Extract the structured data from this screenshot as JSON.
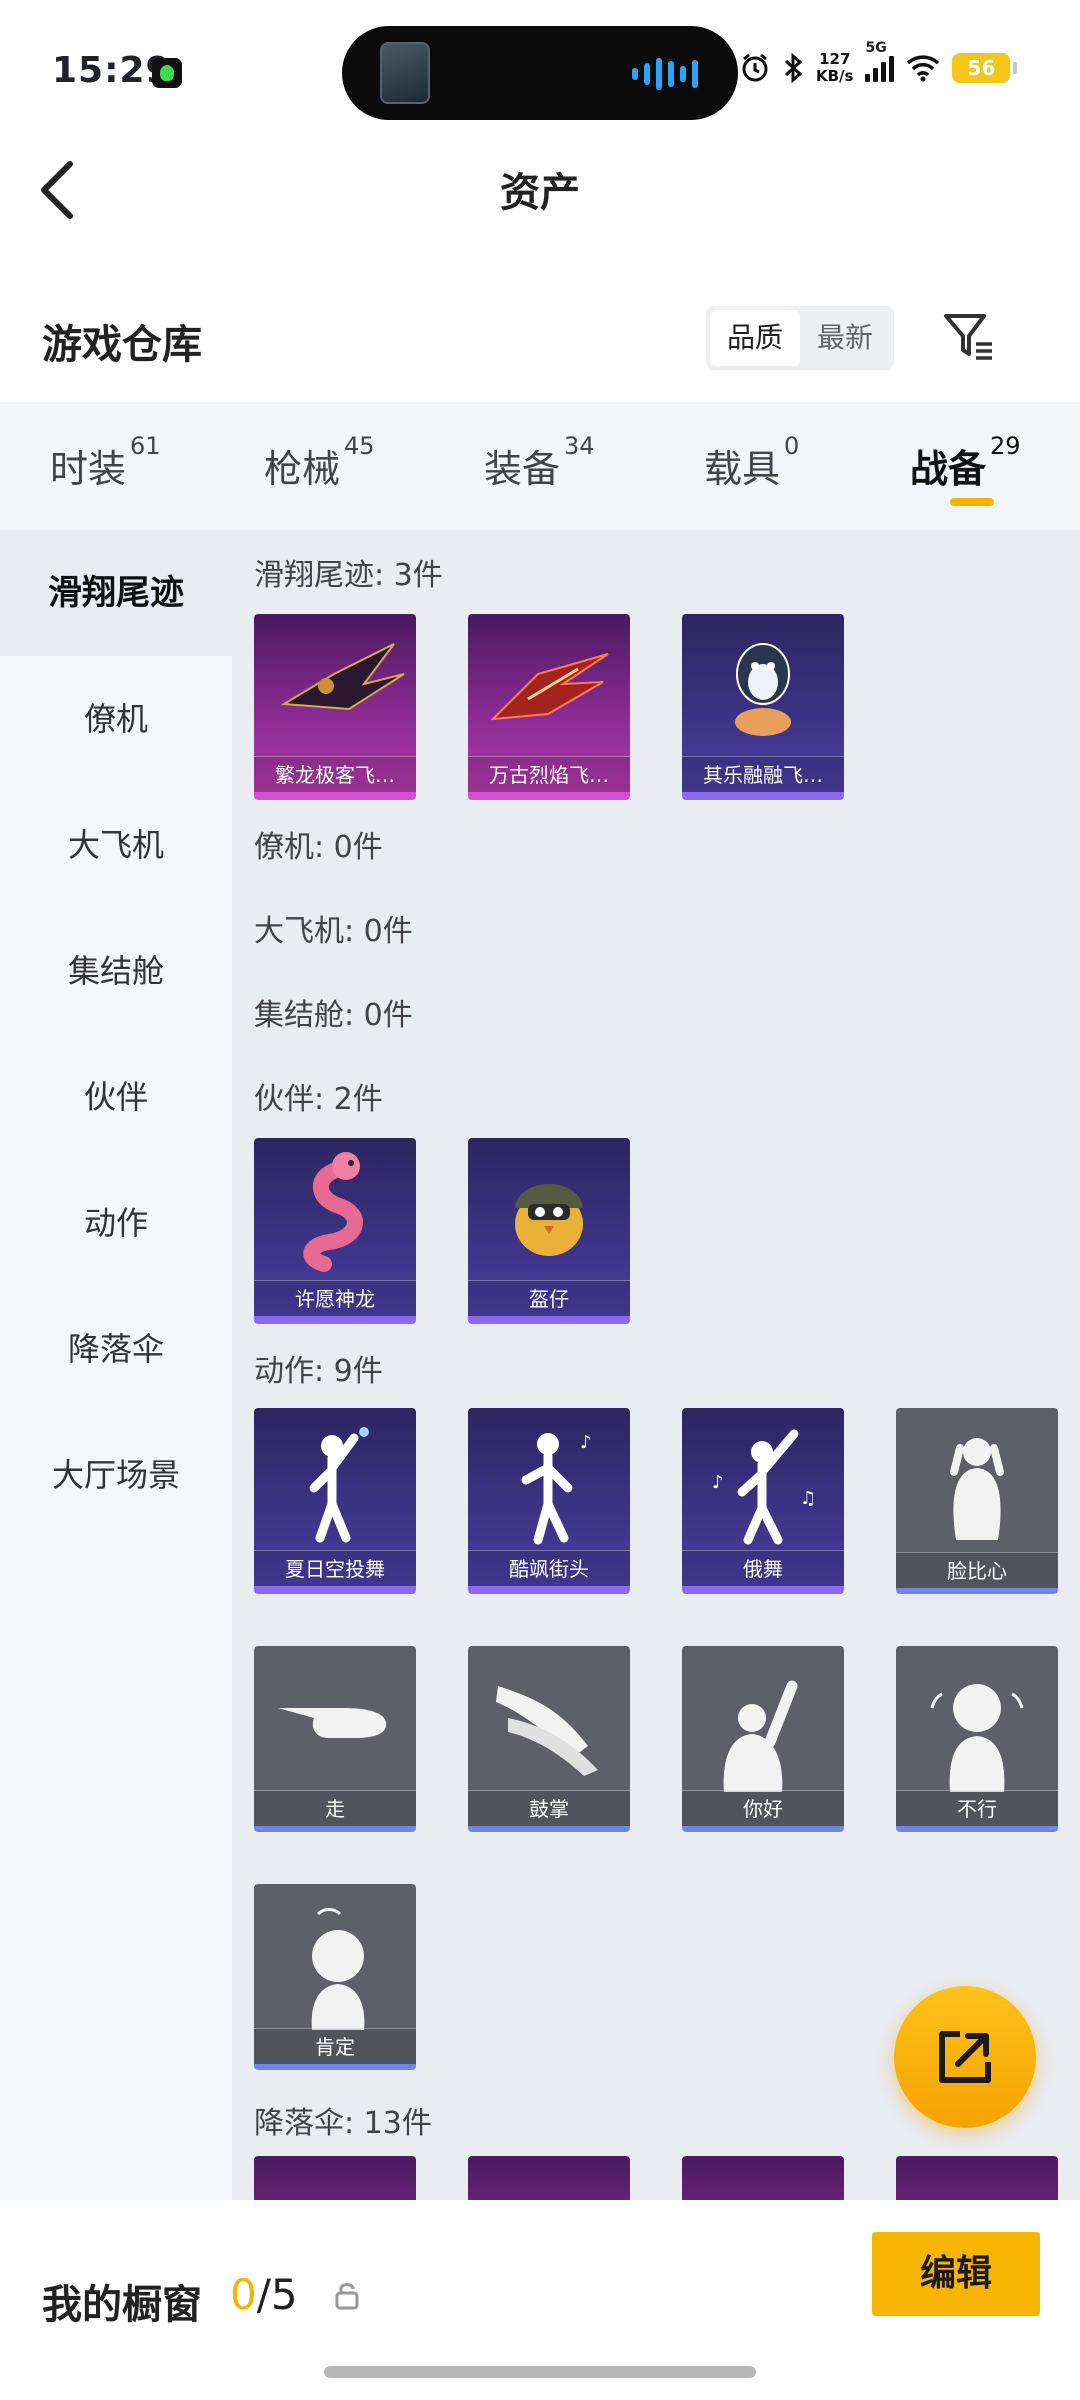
{
  "status_bar": {
    "time": "15:29",
    "net_speed_top": "127",
    "net_speed_bottom": "KB/s",
    "signal_label": "5G",
    "battery": "56",
    "icons": [
      "alarm-icon",
      "bluetooth-icon",
      "wifi-icon"
    ]
  },
  "header": {
    "title": "资产",
    "back_icon": "chevron-left-icon"
  },
  "warehouse": {
    "title": "游戏仓库",
    "sort_options": [
      "品质",
      "最新"
    ],
    "sort_selected": "品质",
    "filter_icon": "filter-icon"
  },
  "tabs": [
    {
      "label": "时装",
      "count": "61"
    },
    {
      "label": "枪械",
      "count": "45"
    },
    {
      "label": "装备",
      "count": "34"
    },
    {
      "label": "载具",
      "count": "0"
    },
    {
      "label": "战备",
      "count": "29"
    }
  ],
  "active_tab": "战备",
  "sidebar": {
    "items": [
      "滑翔尾迹",
      "僚机",
      "大飞机",
      "集结舱",
      "伙伴",
      "动作",
      "降落伞",
      "大厅场景"
    ],
    "active": "滑翔尾迹"
  },
  "sections": {
    "glide": {
      "title": "滑翔尾迹: 3件",
      "items": [
        "繁龙极客飞…",
        "万古烈焰飞…",
        "其乐融融飞…"
      ]
    },
    "wingman": {
      "title": "僚机: 0件"
    },
    "big_plane": {
      "title": "大飞机: 0件"
    },
    "rally_pod": {
      "title": "集结舱: 0件"
    },
    "partner": {
      "title": "伙伴: 2件",
      "items": [
        "许愿神龙",
        "盔仔"
      ]
    },
    "emote": {
      "title": "动作: 9件",
      "items": [
        "夏日空投舞",
        "酷飒街头",
        "俄舞",
        "脸比心",
        "走",
        "鼓掌",
        "你好",
        "不行",
        "肯定"
      ]
    },
    "parachute": {
      "title": "降落伞: 13件"
    }
  },
  "bottom_bar": {
    "label": "我的橱窗",
    "count_current": "0",
    "count_sep_total": "/5",
    "edit_label": "编辑",
    "lock_icon": "lock-icon",
    "share_icon": "share-icon"
  },
  "colors": {
    "accent": "#f5b400",
    "tab_bg": "#f3f5f8",
    "content_bg": "#e9ecf1"
  }
}
